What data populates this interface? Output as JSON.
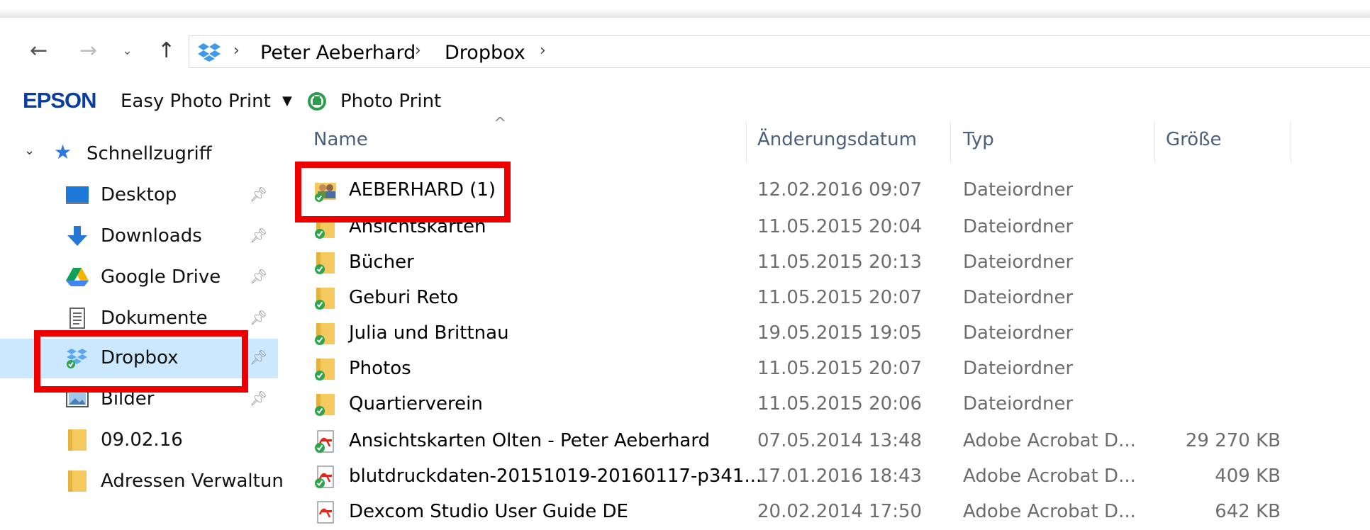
{
  "nav": {
    "breadcrumb": [
      "Peter Aeberhard",
      "Dropbox"
    ]
  },
  "toolbar": {
    "brand": "EPSON",
    "easy_photo_print": "Easy Photo Print",
    "photo_print": "Photo Print"
  },
  "sidebar": {
    "quick_access": "Schnellzugriff",
    "items": [
      {
        "label": "Desktop",
        "icon": "desktop-icon",
        "pinned": true
      },
      {
        "label": "Downloads",
        "icon": "download-arrow-icon",
        "pinned": true
      },
      {
        "label": "Google Drive",
        "icon": "google-drive-icon",
        "pinned": true
      },
      {
        "label": "Dokumente",
        "icon": "document-icon",
        "pinned": true
      },
      {
        "label": "Dropbox",
        "icon": "dropbox-icon",
        "pinned": true,
        "selected": true
      },
      {
        "label": "Bilder",
        "icon": "pictures-icon",
        "pinned": true
      },
      {
        "label": "09.02.16",
        "icon": "folder-icon",
        "pinned": false
      },
      {
        "label": "Adressen Verwaltun",
        "icon": "folder-icon",
        "pinned": false
      }
    ]
  },
  "columns": {
    "name": "Name",
    "date": "Änderungsdatum",
    "type": "Typ",
    "size": "Größe"
  },
  "files": [
    {
      "name": "AEBERHARD (1)",
      "date": "12.02.2016 09:07",
      "type": "Dateiordner",
      "size": "",
      "icon": "shared-folder-icon"
    },
    {
      "name": "Ansichtskarten",
      "date": "11.05.2015 20:04",
      "type": "Dateiordner",
      "size": "",
      "icon": "synced-folder-icon"
    },
    {
      "name": "Bücher",
      "date": "11.05.2015 20:13",
      "type": "Dateiordner",
      "size": "",
      "icon": "synced-folder-icon"
    },
    {
      "name": "Geburi Reto",
      "date": "11.05.2015 20:07",
      "type": "Dateiordner",
      "size": "",
      "icon": "synced-folder-icon"
    },
    {
      "name": "Julia und Brittnau",
      "date": "19.05.2015 19:05",
      "type": "Dateiordner",
      "size": "",
      "icon": "synced-folder-icon"
    },
    {
      "name": "Photos",
      "date": "11.05.2015 20:07",
      "type": "Dateiordner",
      "size": "",
      "icon": "synced-folder-icon"
    },
    {
      "name": "Quartierverein",
      "date": "11.05.2015 20:06",
      "type": "Dateiordner",
      "size": "",
      "icon": "synced-folder-icon"
    },
    {
      "name": "Ansichtskarten Olten - Peter Aeberhard",
      "date": "07.05.2014 13:48",
      "type": "Adobe Acrobat D...",
      "size": "29 270 KB",
      "icon": "pdf-file-icon"
    },
    {
      "name": "blutdruckdaten-20151019-20160117-p341...",
      "date": "17.01.2016 18:43",
      "type": "Adobe Acrobat D...",
      "size": "409 KB",
      "icon": "pdf-file-icon"
    },
    {
      "name": "Dexcom Studio User Guide DE",
      "date": "20.02.2014 17:50",
      "type": "Adobe Acrobat D...",
      "size": "642 KB",
      "icon": "pdf-file-icon"
    }
  ],
  "colors": {
    "highlight": "#ee0000",
    "selection": "#cce8ff",
    "epson_blue": "#0a3da0",
    "folder_yellow": "#f4c95d",
    "sync_green": "#2da44e"
  }
}
